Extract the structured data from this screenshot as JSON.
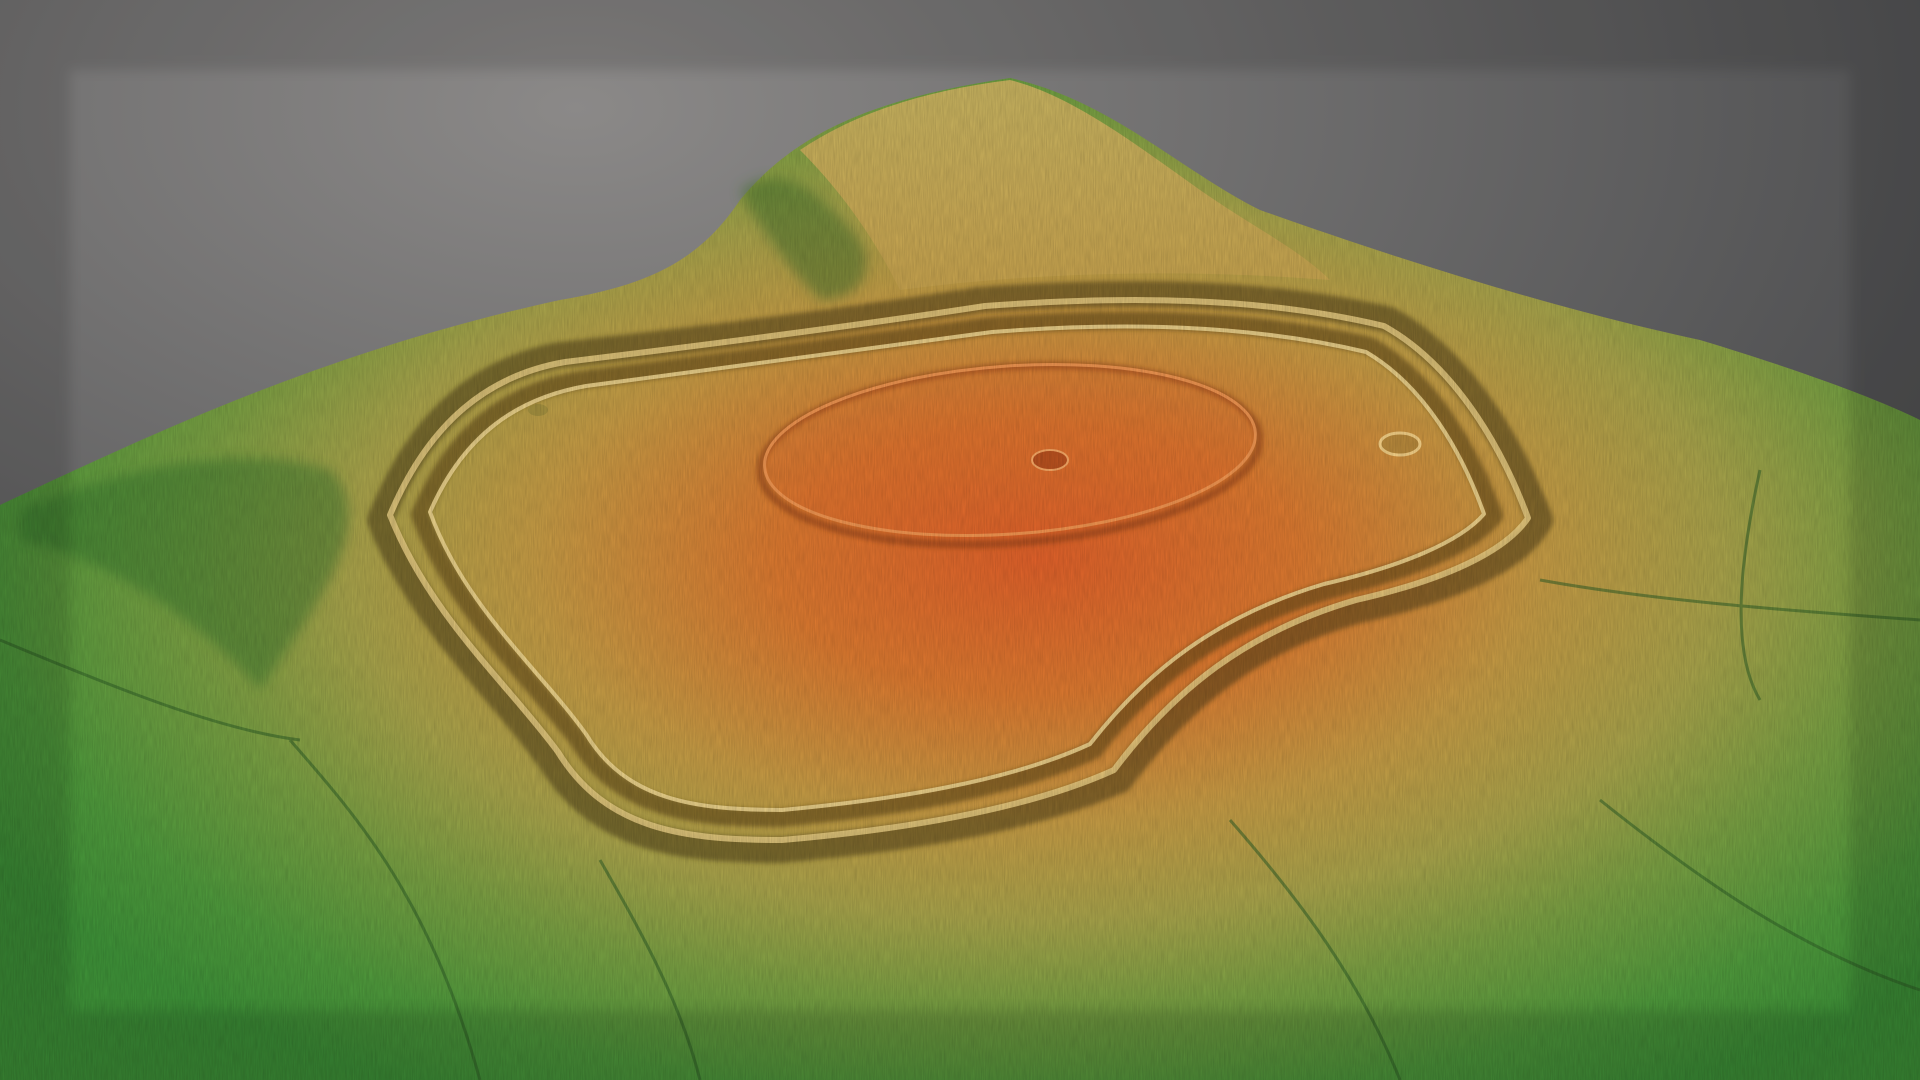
{
  "image": {
    "subject": "lidar-terrain-render",
    "palette": {
      "background_top": "#8a8887",
      "background_bottom": "#3a3b3d",
      "terrain_low": "#3f9a3c",
      "terrain_mid": "#b9a24f",
      "terrain_high": "#e0692a",
      "rampart_shadow": "#4c3a12",
      "rampart_highlight": "#f2d98a"
    }
  }
}
